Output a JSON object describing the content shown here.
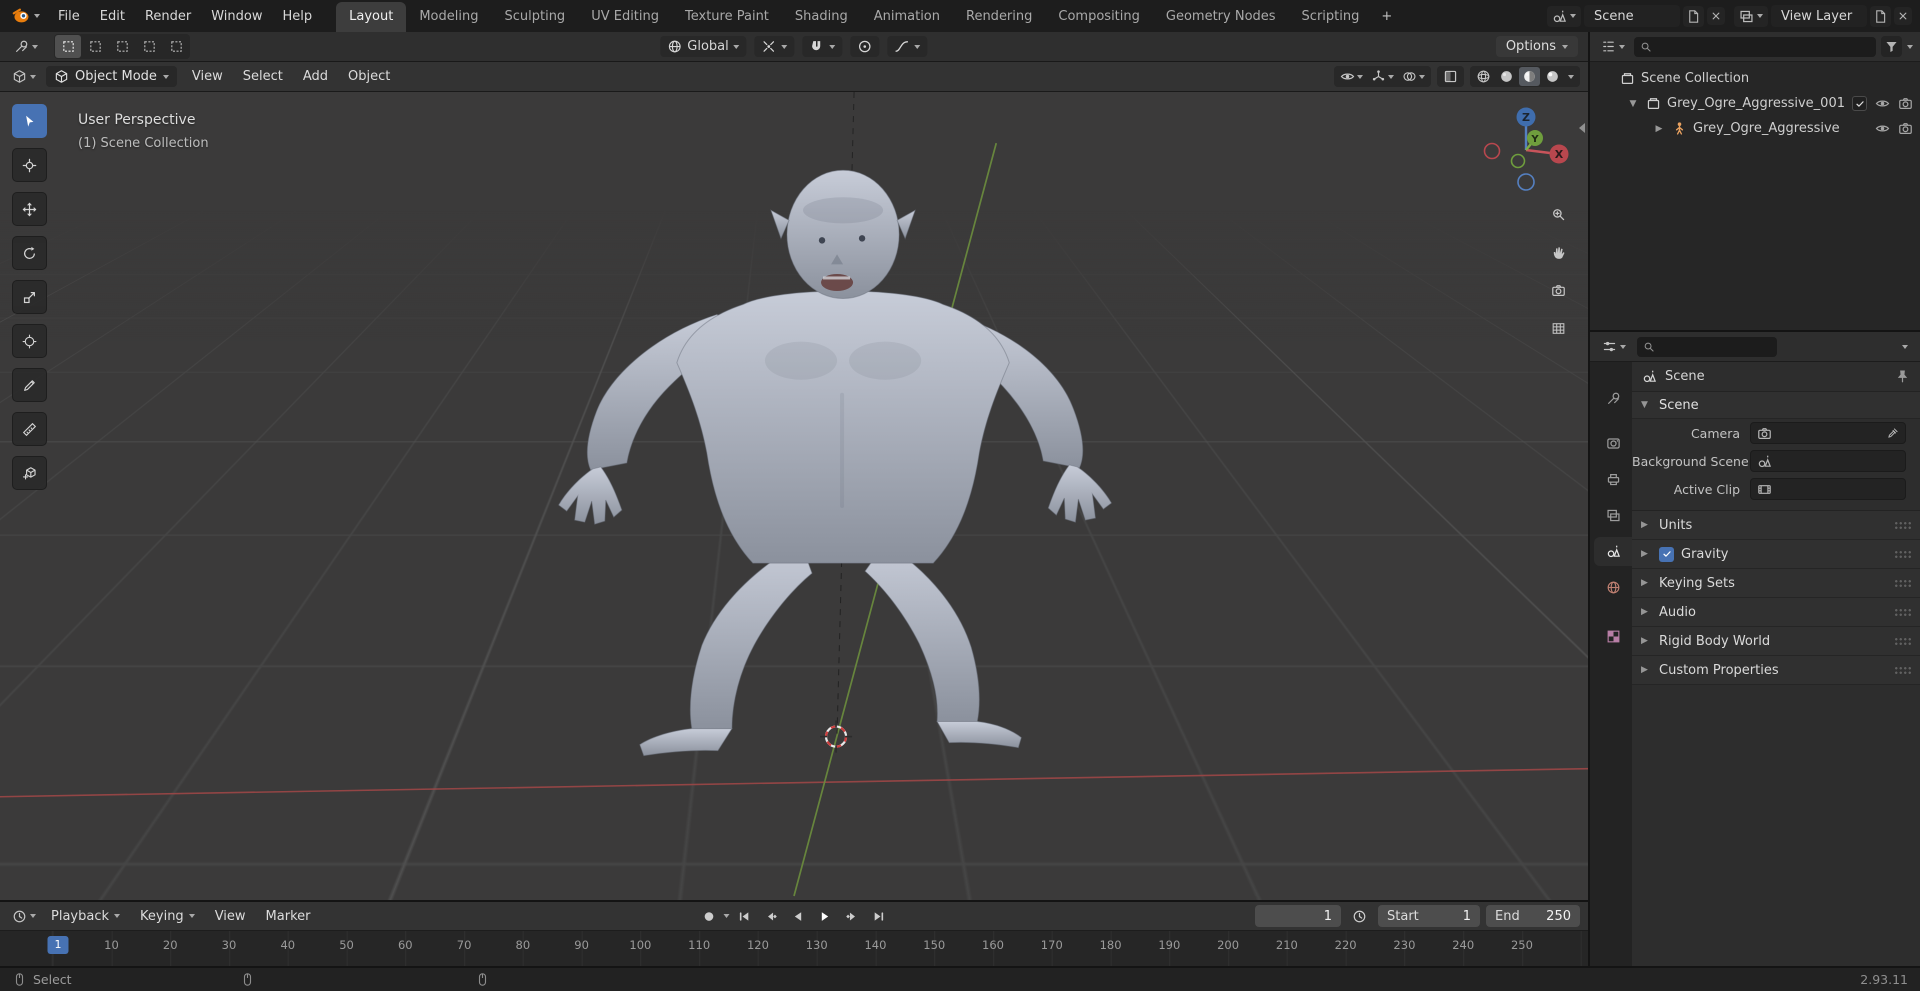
{
  "topbar": {
    "menus": [
      "File",
      "Edit",
      "Render",
      "Window",
      "Help"
    ],
    "workspaces": [
      {
        "label": "Layout",
        "active": true
      },
      {
        "label": "Modeling"
      },
      {
        "label": "Sculpting"
      },
      {
        "label": "UV Editing"
      },
      {
        "label": "Texture Paint"
      },
      {
        "label": "Shading"
      },
      {
        "label": "Animation"
      },
      {
        "label": "Rendering"
      },
      {
        "label": "Compositing"
      },
      {
        "label": "Geometry Nodes"
      },
      {
        "label": "Scripting"
      }
    ],
    "add_workspace_label": "+",
    "scene_selector": {
      "value": "Scene"
    },
    "view_layer_selector": {
      "value": "View Layer"
    }
  },
  "toolrow": {
    "orientation_label": "Global",
    "options_label": "Options"
  },
  "viewport_header": {
    "mode_label": "Object Mode",
    "menus": [
      "View",
      "Select",
      "Add",
      "Object"
    ],
    "toggles": [
      {
        "icon": "eye"
      },
      {
        "icon": "gizmo"
      },
      {
        "icon": "overlay"
      }
    ],
    "shading_modes": [
      {
        "icon": "wireball"
      },
      {
        "icon": "ball"
      },
      {
        "icon": "matball",
        "active": true
      },
      {
        "icon": "renderball"
      }
    ]
  },
  "viewport": {
    "perspective_label": "User Perspective",
    "collection_label": "(1) Scene Collection",
    "gizmo": {
      "x": "X",
      "y": "Y",
      "z": "Z"
    },
    "nav_icons": [
      {
        "icon": "zoom"
      },
      {
        "icon": "hand"
      },
      {
        "icon": "camera"
      },
      {
        "icon": "grid"
      }
    ]
  },
  "tools": [
    {
      "icon": "select",
      "active": true
    },
    {
      "icon": "cursor"
    },
    {
      "icon": "move"
    },
    {
      "icon": "rotate"
    },
    {
      "icon": "scale"
    },
    {
      "icon": "transform"
    },
    {
      "icon": "annotate"
    },
    {
      "icon": "measure"
    },
    {
      "icon": "addcube"
    }
  ],
  "outliner": {
    "search_value": "",
    "rows": [
      {
        "label": "Scene Collection",
        "icon": "collection",
        "level": 0,
        "caret": "",
        "toggles": []
      },
      {
        "label": "Grey_Ogre_Aggressive_001",
        "icon": "collection",
        "level": 1,
        "caret": "▼",
        "toggles": [
          "checkbox",
          "eye",
          "camera"
        ]
      },
      {
        "label": "Grey_Ogre_Aggressive",
        "icon": "armature",
        "level": 2,
        "caret": "▶",
        "toggles": [
          "eye",
          "camera"
        ]
      }
    ]
  },
  "properties": {
    "search_value": "",
    "tabs": [
      {
        "icon": "tool"
      },
      {
        "icon": "render"
      },
      {
        "icon": "printer"
      },
      {
        "icon": "photos"
      },
      {
        "icon": "scene",
        "active": true
      },
      {
        "icon": "world"
      },
      {
        "icon": "checker"
      }
    ],
    "breadcrumb": "Scene",
    "scene_panel": {
      "title": "Scene",
      "caret": "▼",
      "rows": [
        {
          "label": "Camera",
          "icon": "camera",
          "eyedropper": true
        },
        {
          "label": "Background Scene",
          "icon": "scene"
        },
        {
          "label": "Active Clip",
          "icon": "film"
        }
      ]
    },
    "panels": [
      {
        "label": "Units",
        "caret": "▶"
      },
      {
        "label": "Gravity",
        "caret": "▶",
        "checked": true
      },
      {
        "label": "Keying Sets",
        "caret": "▶"
      },
      {
        "label": "Audio",
        "caret": "▶"
      },
      {
        "label": "Rigid Body World",
        "caret": "▶"
      },
      {
        "label": "Custom Properties",
        "caret": "▶"
      }
    ]
  },
  "timeline": {
    "menus": [
      {
        "label": "Playback",
        "chev": true
      },
      {
        "label": "Keying",
        "chev": true
      },
      {
        "label": "View"
      },
      {
        "label": "Marker"
      }
    ],
    "transport": [
      {
        "icon": "skipf"
      },
      {
        "icon": "keyprev"
      },
      {
        "icon": "playl"
      },
      {
        "icon": "playr"
      },
      {
        "icon": "keynext"
      },
      {
        "icon": "skipl"
      }
    ],
    "current_frame": "1",
    "start_label": "Start",
    "start_value": "1",
    "end_label": "End",
    "end_value": "250",
    "marker_frame": "1",
    "ruler_frames": [
      10,
      20,
      30,
      40,
      50,
      60,
      70,
      80,
      90,
      100,
      110,
      120,
      130,
      140,
      150,
      160,
      170,
      180,
      190,
      200,
      210,
      220,
      230,
      240,
      250
    ]
  },
  "statusbar": {
    "hints": [
      {
        "icon": "mouse",
        "label": "Select"
      },
      {
        "icon": "mouse",
        "label": ""
      },
      {
        "icon": "mouse",
        "label": ""
      }
    ],
    "version": "2.93.11"
  },
  "colors": {
    "accent": "#4772b3",
    "axis_x": "#9e4747",
    "axis_y": "#6a8a3e",
    "axis_z": "#3f6dad"
  }
}
